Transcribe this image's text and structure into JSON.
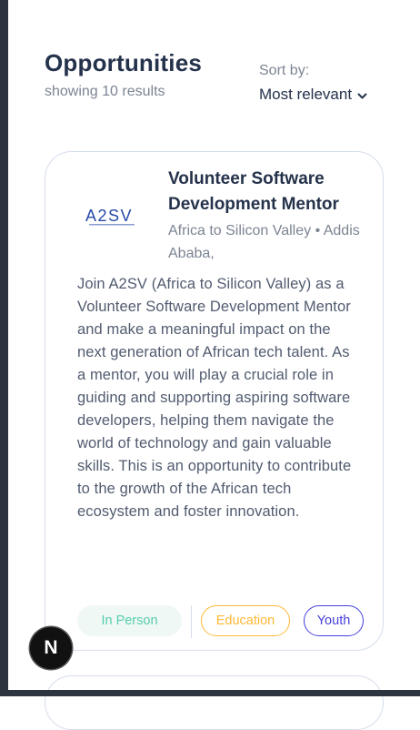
{
  "header": {
    "title": "Opportunities",
    "subtitle": "showing 10 results",
    "sort_label": "Sort by:",
    "sort_value": "Most relevant"
  },
  "jobs": [
    {
      "title": "Volunteer Software Development Mentor",
      "company": "Africa to Silicon Valley",
      "separator": "•",
      "location": "Addis Ababa,",
      "logo_text": "A2SV",
      "description": "Join A2SV (Africa to Silicon Valley) as a Volunteer Software Development Mentor and make a meaningful impact on the next generation of African tech talent. As a mentor, you will play a crucial role in guiding and supporting aspiring software developers, helping them navigate the world of technology and gain valuable skills. This is an opportunity to contribute to the growth of the African tech ecosystem and foster innovation.",
      "tags": [
        "In Person",
        "Education",
        "Youth"
      ]
    }
  ],
  "dev_badge": {
    "letter": "N"
  },
  "icons": {
    "sort": "chevron-down-icon",
    "logo": "a2sv-logo"
  },
  "colors": {
    "title": "#25324b",
    "muted": "#7c8493",
    "body_text": "#515b6f",
    "in_person": "#56cdad",
    "education": "#ffb836",
    "youth": "#4640de",
    "logo_blue": "#264ba7",
    "card_border": "#d6ddeb",
    "side_bar": "#2d3440"
  }
}
